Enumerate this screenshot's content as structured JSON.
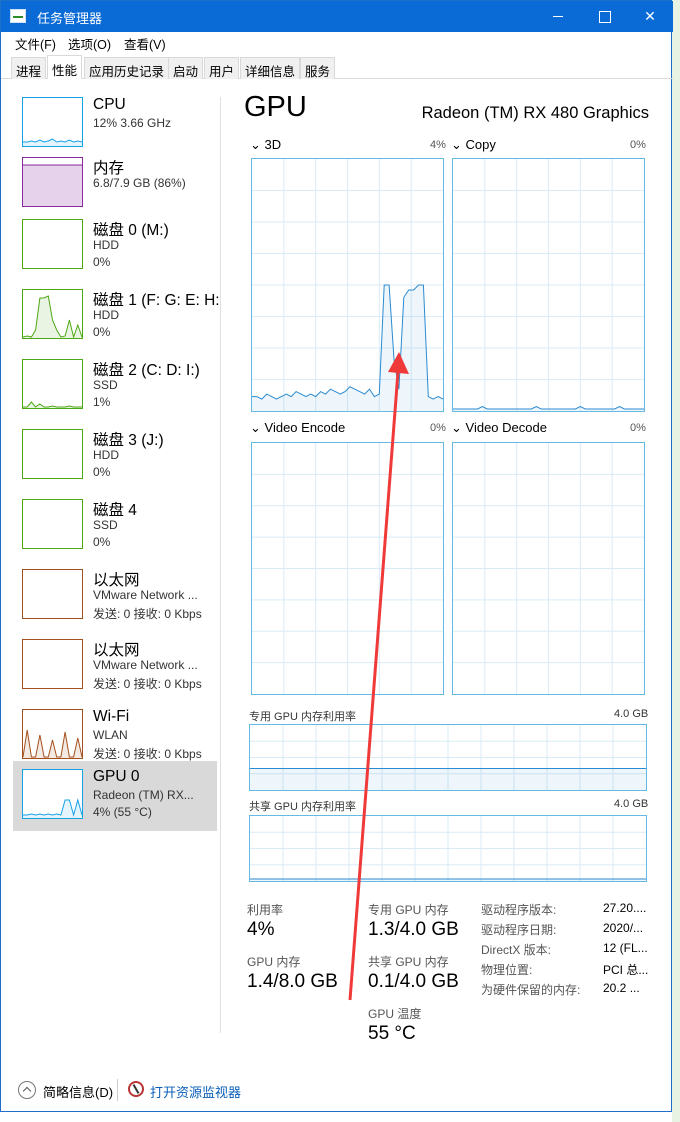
{
  "window": {
    "title": "任务管理器",
    "min_icon": "minimize-icon",
    "max_icon": "maximize-icon",
    "close_icon": "close-icon",
    "close_glyph": "✕"
  },
  "menu": [
    {
      "label": "文件(F)"
    },
    {
      "label": "选项(O)"
    },
    {
      "label": "查看(V)"
    }
  ],
  "tabs": [
    {
      "label": "进程",
      "active": false
    },
    {
      "label": "性能",
      "active": true
    },
    {
      "label": "应用历史记录",
      "active": false
    },
    {
      "label": "启动",
      "active": false
    },
    {
      "label": "用户",
      "active": false
    },
    {
      "label": "详细信息",
      "active": false
    },
    {
      "label": "服务",
      "active": false
    }
  ],
  "sidebar": {
    "items": [
      {
        "name": "CPU",
        "sub1": "12%  3.66 GHz",
        "sub2": "",
        "color": "#17a2e6"
      },
      {
        "name": "内存",
        "sub1": "6.8/7.9 GB (86%)",
        "sub2": "",
        "color": "#8b2a9e"
      },
      {
        "name": "磁盘 0 (M:)",
        "sub1": "HDD",
        "sub2": "0%",
        "color": "#4da813"
      },
      {
        "name": "磁盘 1 (F: G: E: H:",
        "sub1": "HDD",
        "sub2": "0%",
        "color": "#4da813"
      },
      {
        "name": "磁盘 2 (C: D: I:)",
        "sub1": "SSD",
        "sub2": "1%",
        "color": "#4da813"
      },
      {
        "name": "磁盘 3 (J:)",
        "sub1": "HDD",
        "sub2": "0%",
        "color": "#4da813"
      },
      {
        "name": "磁盘 4",
        "sub1": "SSD",
        "sub2": "0%",
        "color": "#4da813"
      },
      {
        "name": "以太网",
        "sub1": "VMware Network ...",
        "sub2": "发送: 0 接收: 0 Kbps",
        "color": "#a4501e"
      },
      {
        "name": "以太网",
        "sub1": "VMware Network ...",
        "sub2": "发送: 0 接收: 0 Kbps",
        "color": "#a4501e"
      },
      {
        "name": "Wi-Fi",
        "sub1": "WLAN",
        "sub2": "发送: 0 接收: 0 Kbps",
        "color": "#a4501e"
      },
      {
        "name": "GPU 0",
        "sub1": "Radeon (TM) RX...",
        "sub2": "4% (55 °C)",
        "color": "#17a2e6",
        "selected": true
      }
    ]
  },
  "gpu": {
    "heading": "GPU",
    "model": "Radeon (TM) RX 480 Graphics",
    "engines": [
      {
        "label": "3D",
        "pct": "4%",
        "values": [
          5,
          5,
          4,
          6,
          5,
          4,
          5,
          6,
          5,
          7,
          6,
          5,
          6,
          5,
          7,
          6,
          8,
          7,
          6,
          7,
          9,
          8,
          7,
          6,
          8,
          5,
          6,
          50,
          50,
          20,
          8,
          45,
          48,
          48,
          50,
          50,
          5,
          4,
          5,
          4
        ]
      },
      {
        "label": "Copy",
        "pct": "0%",
        "values": [
          0,
          0,
          0,
          0,
          0,
          0,
          1,
          0,
          0,
          0,
          0,
          0,
          0,
          0,
          0,
          0,
          0,
          1,
          0,
          0,
          0,
          0,
          0,
          0,
          0,
          0,
          1,
          0,
          0,
          0,
          0,
          0,
          0,
          0,
          1,
          0,
          0,
          0,
          0,
          0
        ]
      },
      {
        "label": "Video Encode",
        "pct": "0%",
        "values": []
      },
      {
        "label": "Video Decode",
        "pct": "0%",
        "values": []
      }
    ],
    "dedicated_mem": {
      "label": "专用 GPU 内存利用率",
      "max": "4.0 GB",
      "fraction": 0.33
    },
    "shared_mem": {
      "label": "共享 GPU 内存利用率",
      "max": "4.0 GB",
      "fraction": 0.03
    },
    "stats": {
      "util_label": "利用率",
      "util_val": "4%",
      "gpu_mem_label": "GPU 内存",
      "gpu_mem_val": "1.4/8.0 GB",
      "ded_label": "专用 GPU 内存",
      "ded_val": "1.3/4.0 GB",
      "shared_label": "共享 GPU 内存",
      "shared_val": "0.1/4.0 GB",
      "temp_label": "GPU 温度",
      "temp_val": "55 °C"
    },
    "details": [
      {
        "label": "驱动程序版本:",
        "value": "27.20...."
      },
      {
        "label": "驱动程序日期:",
        "value": "2020/..."
      },
      {
        "label": "DirectX 版本:",
        "value": "12 (FL..."
      },
      {
        "label": "物理位置:",
        "value": "PCI 总..."
      },
      {
        "label": "为硬件保留的内存:",
        "value": "20.2 ..."
      }
    ]
  },
  "footer": {
    "fewer_details": "简略信息(D)",
    "open_monitor": "打开资源监视器"
  },
  "annotation_color": "#f03a3a"
}
